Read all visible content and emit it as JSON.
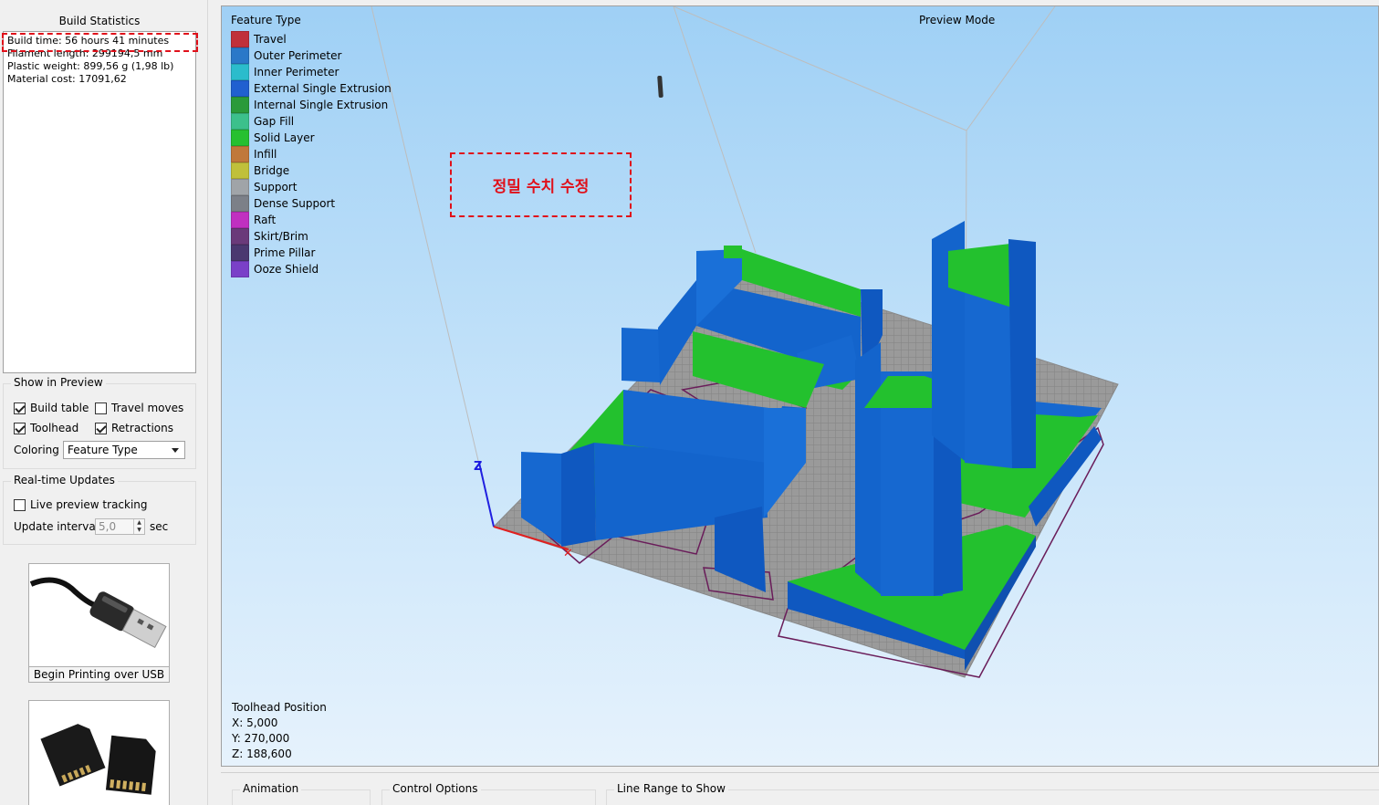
{
  "left": {
    "stats_title": "Build Statistics",
    "stats": [
      "Build time: 56 hours 41 minutes",
      "Filament length: 299194,5 mm",
      "Plastic weight: 899,56 g (1,98 lb)",
      "Material cost: 17091,62"
    ],
    "show_in_preview": {
      "title": "Show in Preview",
      "build_table": {
        "label": "Build table",
        "checked": true
      },
      "travel_moves": {
        "label": "Travel moves",
        "checked": false
      },
      "toolhead": {
        "label": "Toolhead",
        "checked": true
      },
      "retractions": {
        "label": "Retractions",
        "checked": true
      },
      "coloring_label": "Coloring",
      "coloring_value": "Feature Type"
    },
    "realtime": {
      "title": "Real-time Updates",
      "live_tracking": {
        "label": "Live preview tracking",
        "checked": false
      },
      "interval_label": "Update interval",
      "interval_value": "5,0",
      "interval_unit": "sec"
    },
    "usb_button": "Begin Printing over USB"
  },
  "preview": {
    "legend_title": "Feature Type",
    "mode_label": "Preview Mode",
    "legend": [
      {
        "label": "Travel",
        "color": "#c0303a"
      },
      {
        "label": "Outer Perimeter",
        "color": "#2a78c8"
      },
      {
        "label": "Inner Perimeter",
        "color": "#2bbccc"
      },
      {
        "label": "External Single Extrusion",
        "color": "#2060d0"
      },
      {
        "label": "Internal Single Extrusion",
        "color": "#2a9a3a"
      },
      {
        "label": "Gap Fill",
        "color": "#3cc08c"
      },
      {
        "label": "Solid Layer",
        "color": "#26c030"
      },
      {
        "label": "Infill",
        "color": "#c0783a"
      },
      {
        "label": "Bridge",
        "color": "#c0c03a"
      },
      {
        "label": "Support",
        "color": "#a0a4a8"
      },
      {
        "label": "Dense Support",
        "color": "#7c8088"
      },
      {
        "label": "Raft",
        "color": "#c030c0"
      },
      {
        "label": "Skirt/Brim",
        "color": "#6a3a7a"
      },
      {
        "label": "Prime Pillar",
        "color": "#4a3870"
      },
      {
        "label": "Ooze Shield",
        "color": "#7a40c8"
      }
    ],
    "annotation": "정밀 수치 수정",
    "axis_z": "Z",
    "toolhead": {
      "title": "Toolhead Position",
      "x": "X: 5,000",
      "y": "Y: 270,000",
      "z": "Z: 188,600"
    }
  },
  "bottom": {
    "animation": "Animation",
    "control_options": "Control Options",
    "line_range": "Line Range to Show"
  }
}
